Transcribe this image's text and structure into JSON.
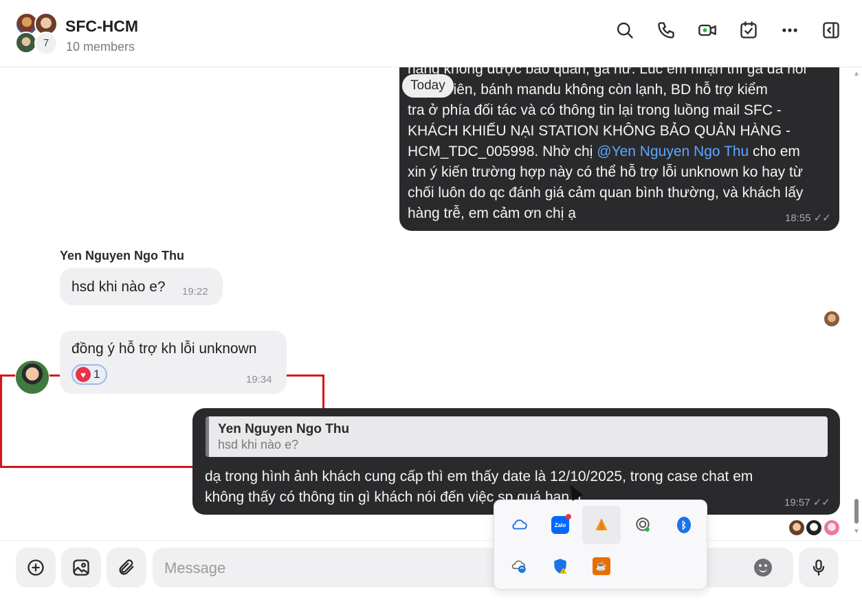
{
  "header": {
    "title": "SFC-HCM",
    "subtitle": "10 members",
    "extra_member_count": "7",
    "icons": [
      "search-icon",
      "phone-icon",
      "video-icon",
      "calendar-check-icon",
      "more-icon",
      "panel-toggle-icon"
    ]
  },
  "chat": {
    "date_separator": "Today",
    "messages": [
      {
        "id": "m1",
        "direction": "outgoing",
        "lines": [
          "hàng không được bảo quản, gà hư. Lúc em nhận thì gà đã hôi",
          "và cá viên, bánh mandu không còn lạnh, BD hỗ trợ kiểm",
          "tra ở phía đối tác và có thông tin lại trong luồng mail SFC -",
          "KHÁCH KHIẾU NẠI STATION KHÔNG BẢO QUẢN HÀNG -"
        ],
        "line5_before": "HCM_TDC_005998. Nhờ chị ",
        "mention": "@Yen Nguyen Ngo Thu",
        "line5_after": " cho em",
        "lines_after": [
          "xin ý kiến trường hợp này có thể hỗ trợ lỗi unknown ko hay từ",
          "chối luôn do qc đánh giá cảm quan bình thường, và khách lấy",
          "hàng trễ, em cảm ơn chị ạ"
        ],
        "time": "18:55",
        "status": "✓✓"
      },
      {
        "id": "m2",
        "direction": "incoming",
        "sender": "Yen Nguyen Ngo Thu",
        "text": "hsd khi nào e?",
        "time": "19:22"
      },
      {
        "id": "m3",
        "direction": "incoming",
        "text": "đồng ý hỗ trợ kh lỗi unknown",
        "reaction_count": "1",
        "time": "19:34"
      },
      {
        "id": "m4",
        "direction": "outgoing",
        "quote_name": "Yen Nguyen Ngo Thu",
        "quote_text": "hsd khi nào e?",
        "line1": "dạ trong hình ảnh khách cung cấp thì em thấy date là 12/10/2025, trong case chat em",
        "line2": "không thấy có thông tin gì khách nói đến việc sp quá hạn ạ",
        "time": "19:57",
        "status": "✓✓"
      }
    ]
  },
  "composer": {
    "placeholder": "Message",
    "icons": [
      "add-icon",
      "image-icon",
      "attachment-icon",
      "emoji-icon",
      "microphone-icon"
    ]
  },
  "tray": {
    "icons": [
      "onedrive-icon",
      "zalo-icon",
      "tray-app-orange-icon",
      "airplay-status-icon",
      "bluetooth-icon",
      "onedrive-sync-icon",
      "security-warning-icon",
      "java-icon"
    ],
    "zalo_label": "Zalo"
  },
  "colors": {
    "outgoing_bubble": "#2a2a2d",
    "incoming_bubble": "#f0f0f2",
    "mention": "#5ea7ff",
    "highlight_border": "#d4151b",
    "reaction_heart": "#e8334a"
  }
}
